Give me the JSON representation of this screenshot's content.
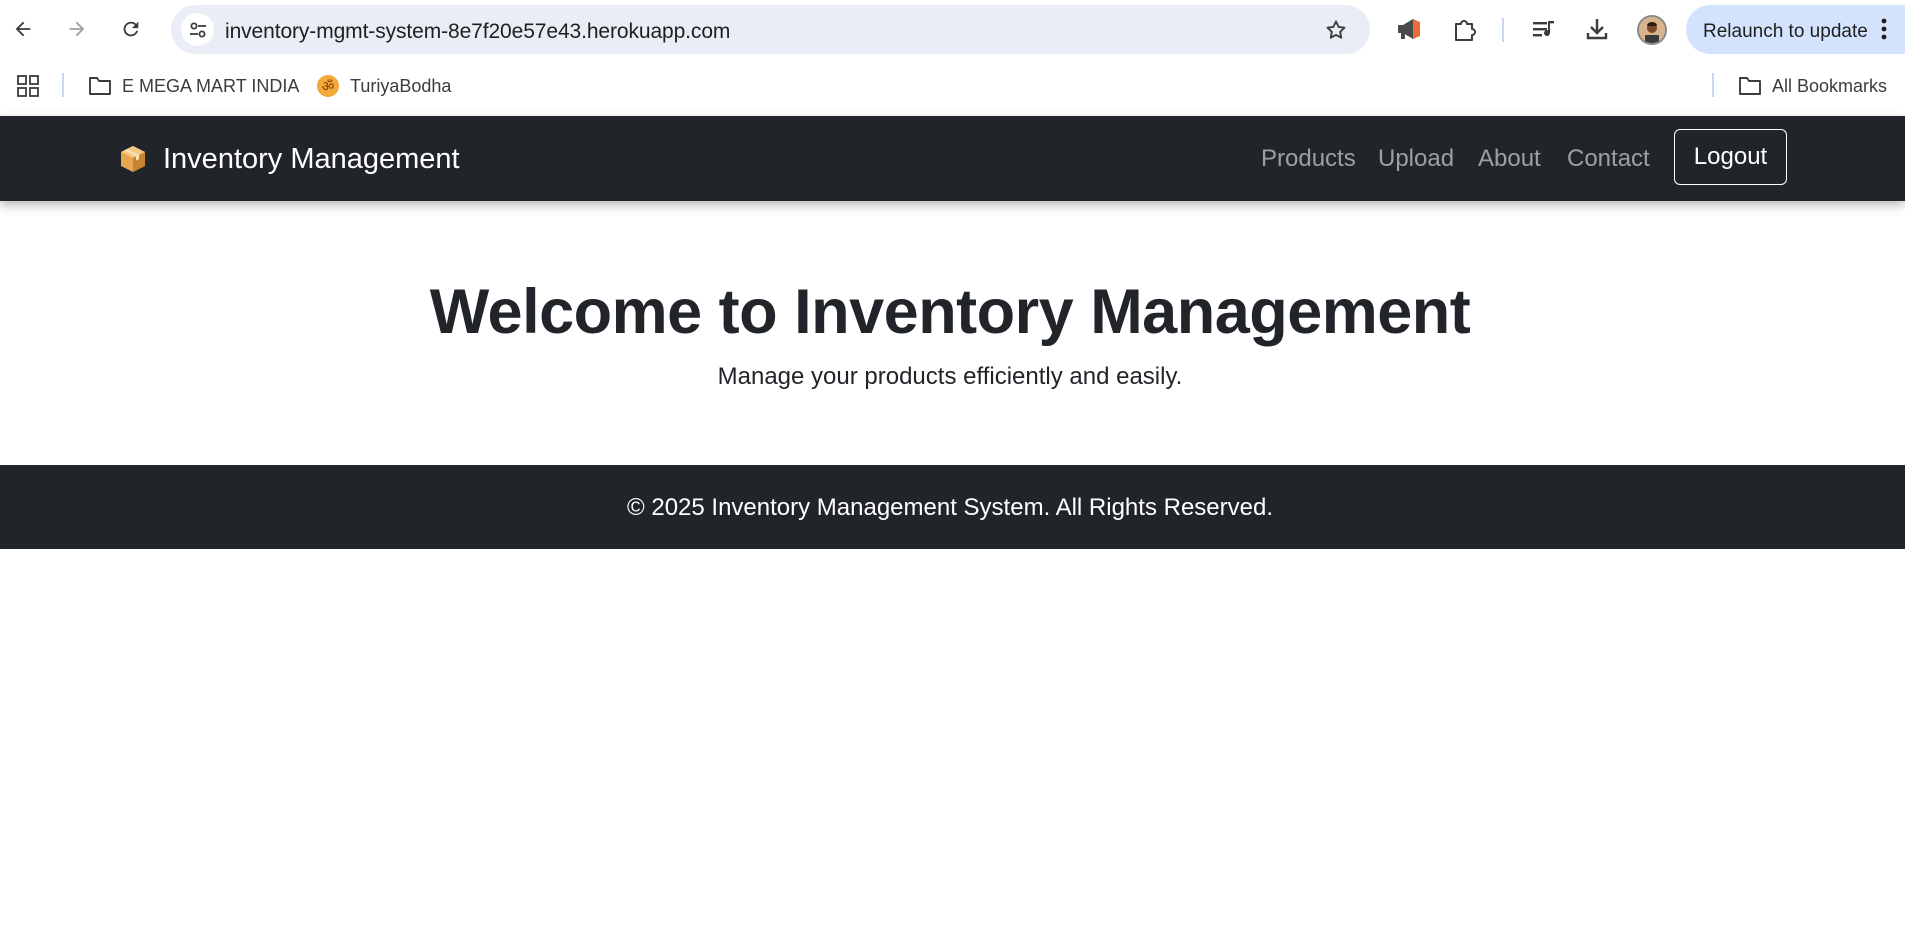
{
  "browser": {
    "url": "inventory-mgmt-system-8e7f20e57e43.herokuapp.com",
    "relaunch_label": "Relaunch to update",
    "icons": {
      "back": "arrow-left-icon",
      "forward": "arrow-right-icon",
      "reload": "reload-icon",
      "site_info": "tune-icon",
      "bookmark": "star-icon",
      "announcement": "megaphone-icon",
      "extensions": "puzzle-icon",
      "media": "playlist-icon",
      "downloads": "download-icon",
      "more": "vertical-dots-icon"
    }
  },
  "bookmarks": {
    "items": [
      {
        "label": "E MEGA MART INDIA",
        "icon": "folder-icon"
      },
      {
        "label": "TuriyaBodha",
        "icon": "om-favicon-icon"
      }
    ],
    "all_label": "All Bookmarks"
  },
  "site": {
    "brand": "Inventory Management",
    "nav": {
      "products": "Products",
      "upload": "Upload",
      "about": "About",
      "contact": "Contact",
      "logout": "Logout"
    },
    "hero": {
      "title": "Welcome to Inventory Management",
      "subtitle": "Manage your products efficiently and easily."
    },
    "footer": "© 2025 Inventory Management System. All Rights Reserved."
  },
  "colors": {
    "navbar_bg": "#212529",
    "nav_link": "#9da0a3",
    "omnibox_bg": "#e9eef6",
    "relaunch_bg": "#d3e3fd",
    "text_dark": "#212529"
  }
}
